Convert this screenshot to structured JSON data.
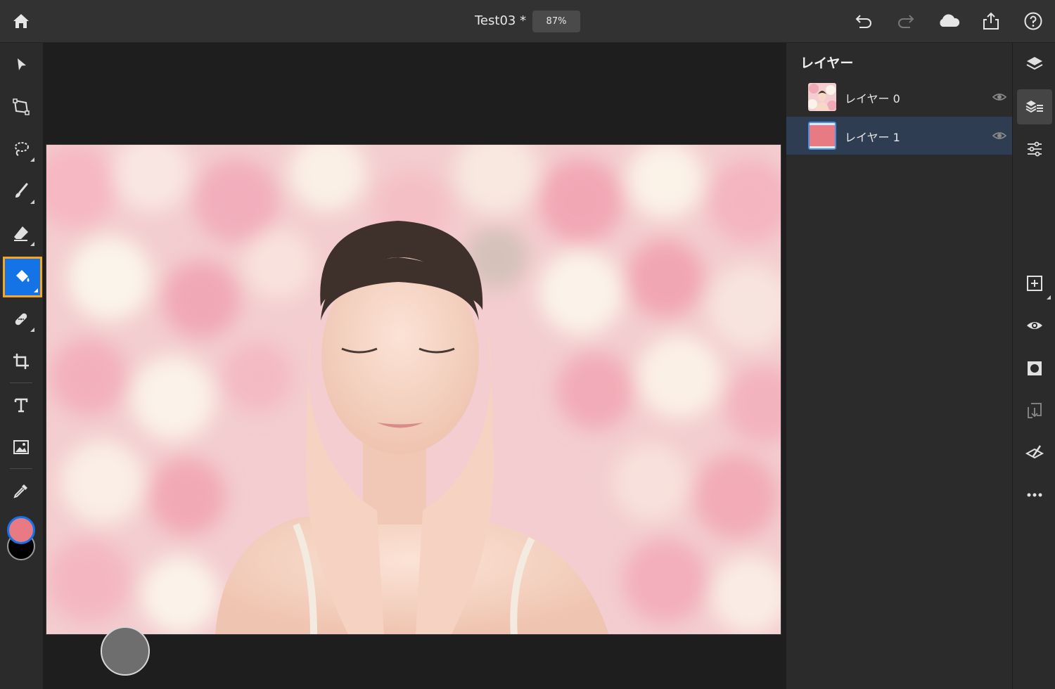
{
  "header": {
    "document_title": "Test03 *",
    "zoom_level": "87%"
  },
  "layers_panel": {
    "title": "レイヤー",
    "layers": [
      {
        "name": "レイヤー 0",
        "visible": true,
        "selected": false,
        "thumbnail": "photo-thumbnail"
      },
      {
        "name": "レイヤー 1",
        "visible": true,
        "selected": true,
        "thumbnail": "pink-fill",
        "fill_color": "#e87a84"
      }
    ]
  },
  "left_toolbar": {
    "tools": [
      "select-tool",
      "transform-tool",
      "lasso-tool",
      "brush-tool",
      "eraser-tool",
      "paint-bucket-tool",
      "healing-tool",
      "crop-tool",
      "text-tool",
      "place-image-tool",
      "eyedropper-tool"
    ],
    "active_tool": "paint-bucket-tool",
    "foreground_color": "#e87a84",
    "background_color": "#000000"
  },
  "right_toolbar": {
    "items": [
      "layers-icon",
      "layer-properties-icon",
      "adjustments-icon",
      "add-layer-icon",
      "visibility-icon",
      "mask-icon",
      "merge-down-icon",
      "clear-layer-icon",
      "more-icon"
    ],
    "active_item": "layer-properties-icon"
  },
  "accent_colors": {
    "primary": "#1473e6",
    "highlight": "#f5a623"
  }
}
